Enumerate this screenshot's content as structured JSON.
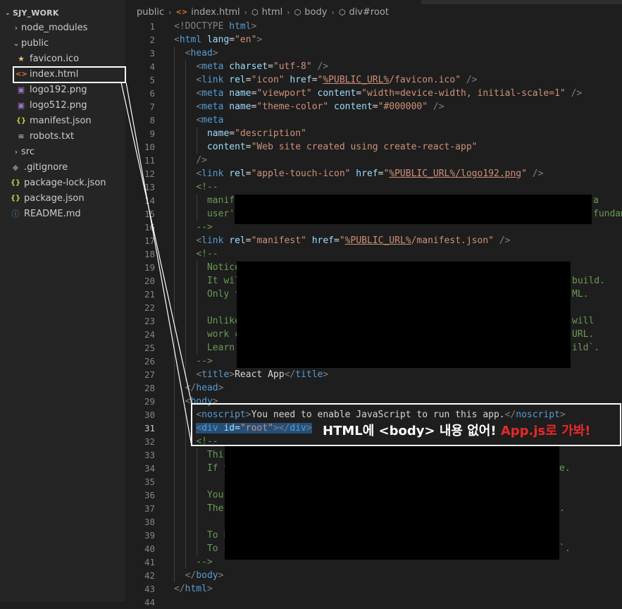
{
  "explorer": {
    "title": "SJY_WORK",
    "items": [
      {
        "label": "node_modules",
        "type": "folder",
        "icon": "chevron-right-icon"
      },
      {
        "label": "public",
        "type": "folder-open",
        "icon": "chevron-down-icon"
      },
      {
        "label": "favicon.ico",
        "type": "file",
        "icon": "star-icon"
      },
      {
        "label": "index.html",
        "type": "file",
        "icon": "html-icon"
      },
      {
        "label": "logo192.png",
        "type": "file",
        "icon": "image-icon"
      },
      {
        "label": "logo512.png",
        "type": "file",
        "icon": "image-icon"
      },
      {
        "label": "manifest.json",
        "type": "file",
        "icon": "json-icon"
      },
      {
        "label": "robots.txt",
        "type": "file",
        "icon": "lines-icon"
      },
      {
        "label": "src",
        "type": "folder",
        "icon": "chevron-right-icon"
      },
      {
        "label": ".gitignore",
        "type": "file",
        "icon": "git-icon"
      },
      {
        "label": "package-lock.json",
        "type": "file",
        "icon": "json-icon"
      },
      {
        "label": "package.json",
        "type": "file",
        "icon": "json-icon"
      },
      {
        "label": "README.md",
        "type": "file",
        "icon": "info-icon"
      }
    ]
  },
  "breadcrumb": [
    "public",
    "index.html",
    "html",
    "body",
    "div#root"
  ],
  "line_numbers": [
    "1",
    "2",
    "3",
    "4",
    "5",
    "6",
    "7",
    "8",
    "9",
    "10",
    "11",
    "12",
    "13",
    "14",
    "15",
    "16",
    "17",
    "18",
    "19",
    "20",
    "21",
    "22",
    "23",
    "24",
    "25",
    "26",
    "27",
    "28",
    "29",
    "30",
    "31",
    "32",
    "33",
    "34",
    "35",
    "36",
    "37",
    "38",
    "39",
    "40",
    "41",
    "42",
    "43",
    "44"
  ],
  "code": {
    "l1_a": "<!DOCTYPE ",
    "l1_b": "html",
    "l1_c": ">",
    "l2_a": "<",
    "l2_b": "html",
    "l2_c": " lang",
    "l2_d": "=",
    "l2_e": "\"en\"",
    "l2_f": ">",
    "l3_a": "<",
    "l3_b": "head",
    "l3_c": ">",
    "l4_b": "meta",
    "l4_c": " charset",
    "l4_e": "\"utf-8\"",
    "l4_f": " />",
    "l5_b": "link",
    "l5_c": " rel",
    "l5_e": "\"icon\"",
    "l5_g": " href",
    "l5_h": "\"",
    "l5_i": "%PUBLIC_URL%",
    "l5_j": "/favicon.ico",
    "l5_k": "\"",
    "l5_f": " />",
    "l6_b": "meta",
    "l6_c": " name",
    "l6_e": "\"viewport\"",
    "l6_g": " content",
    "l6_h": "\"width=device-width, initial-scale=1\"",
    "l6_f": " />",
    "l7_b": "meta",
    "l7_c": " name",
    "l7_e": "\"theme-color\"",
    "l7_g": " content",
    "l7_h": "\"#000000\"",
    "l7_f": " />",
    "l8_b": "meta",
    "l9_c": "name",
    "l9_e": "\"description\"",
    "l10_c": "content",
    "l10_e": "\"Web site created using create-react-app\"",
    "l11_a": "/>",
    "l12_b": "link",
    "l12_c": " rel",
    "l12_e": "\"apple-touch-icon\"",
    "l12_g": " href",
    "l12_h": "\"",
    "l12_i": "%PUBLIC_URL%",
    "l12_j": "/logo192.png",
    "l12_k": "\"",
    "l12_f": " />",
    "l13_a": "<!--",
    "l14_a": "manif",
    "l14_b": "a",
    "l15_a": "user'",
    "l15_b": "fundam",
    "l16_a": "-->",
    "l17_b": "link",
    "l17_c": " rel",
    "l17_e": "\"manifest\"",
    "l17_g": " href",
    "l17_h": "\"",
    "l17_i": "%PUBLIC_URL%",
    "l17_j": "/manifest.json",
    "l17_k": "\"",
    "l17_f": " />",
    "l18_a": "<!--",
    "l19_a": "Notice",
    "l20_a": "It wil",
    "l20_b": "build.",
    "l21_a": "Only f",
    "l21_b": "ML.",
    "l23_a": "Unlike",
    "l23_b": "will",
    "l24_a": "work c",
    "l24_b": "URL.",
    "l25_a": "Learn",
    "l25_b": "ild`.",
    "l26_a": "-->",
    "l27_b": "title",
    "l27_t": "React App",
    "l27_d": "title",
    "l28_b": "head",
    "l29_b": "body",
    "l30_b": "noscript",
    "l30_t": "You need to enable JavaScript to run this app.",
    "l30_d": "noscript",
    "l31_b": "div",
    "l31_c": " id",
    "l31_e": "\"root\"",
    "l31_d": "div",
    "l32_a": "<!--",
    "l33_a": "This",
    "l34_a": "If y",
    "l34_b": "e.",
    "l36_a": "You",
    "l37_a": "The",
    "l37_b": ".",
    "l39_a": "To b",
    "l40_a": "To c",
    "l40_b": "`.",
    "l41_a": "-->",
    "l42_b": "body",
    "l43_b": "html"
  },
  "annotation": {
    "white_part": "HTML에 <body> 내용 없어! ",
    "red_part": "App.js로 가봐!"
  },
  "colors": {
    "tag": "#569cd6",
    "attribute": "#9cdcfe",
    "string": "#ce9178",
    "comment": "#6a9955",
    "annotation_red": "#e8282a"
  }
}
